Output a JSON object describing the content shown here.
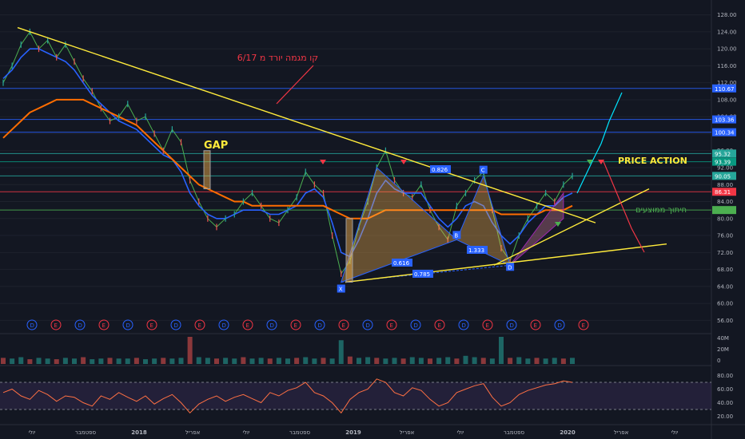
{
  "chart_data": {
    "type": "line",
    "title": "",
    "xlabel": "",
    "ylabel": "",
    "ylim": [
      54,
      130
    ],
    "x_ticks": [
      "יולי",
      "ספטמבר",
      "2018",
      "אפריל",
      "יולי",
      "ספטמבר",
      "2019",
      "אפריל",
      "יולי",
      "ספטמבר",
      "2020",
      "אפריל",
      "יולי"
    ],
    "y_ticks": [
      "128.00",
      "124.00",
      "120.00",
      "116.00",
      "112.00",
      "108.00",
      "104.00",
      "100.00",
      "96.00",
      "92.00",
      "88.00",
      "84.00",
      "80.00",
      "76.00",
      "72.00",
      "68.00",
      "64.00",
      "60.00",
      "56.00"
    ],
    "price_labels": [
      {
        "value": 110.67,
        "text": "110.67",
        "color": "#2962ff"
      },
      {
        "value": 103.36,
        "text": "103.36",
        "color": "#2962ff"
      },
      {
        "value": 100.34,
        "text": "100.34",
        "color": "#2962ff"
      },
      {
        "value": 95.32,
        "text": "95.32",
        "color": "#26a69a"
      },
      {
        "value": 93.39,
        "text": "93.39",
        "color": "#089981"
      },
      {
        "value": 90.05,
        "text": "90.05",
        "color": "#26a69a"
      },
      {
        "value": 86.31,
        "text": "86.31",
        "color": "#f23645"
      },
      {
        "value": 82.0,
        "text": "",
        "color": "#4caf50"
      }
    ],
    "series": [
      {
        "values": [
          112,
          116,
          121,
          124,
          120,
          122,
          118,
          121,
          117,
          113,
          110,
          106,
          103,
          104,
          107,
          103,
          104,
          100,
          96,
          101,
          98,
          89,
          84,
          80,
          78,
          80,
          81,
          84,
          86,
          83,
          80,
          79,
          82,
          85,
          91,
          88,
          86,
          76,
          67,
          70,
          78,
          84,
          92,
          96,
          89,
          86,
          85,
          88,
          82,
          78,
          75,
          83,
          86,
          89,
          91,
          82,
          73,
          70,
          76,
          80,
          83,
          86,
          84,
          88,
          90
        ]
      },
      {
        "values": [
          113,
          115,
          118,
          120,
          120,
          119,
          118,
          117,
          115,
          112,
          109,
          107,
          105,
          103,
          102,
          101,
          99,
          97,
          95,
          94,
          91,
          86,
          83,
          81,
          80,
          80,
          81,
          82,
          82,
          82,
          81,
          81,
          82,
          83,
          86,
          87,
          85,
          79,
          72,
          71,
          75,
          80,
          86,
          89,
          87,
          86,
          86,
          86,
          83,
          80,
          78,
          80,
          83,
          84,
          83,
          79,
          76,
          74,
          76,
          79,
          81,
          83,
          83,
          85,
          86
        ]
      },
      {
        "values": [
          99,
          101,
          103,
          105,
          106,
          107,
          108,
          108,
          108,
          108,
          107,
          106,
          105,
          104,
          103,
          102,
          100,
          98,
          96,
          94,
          92,
          90,
          88,
          87,
          86,
          85,
          84,
          84,
          83,
          83,
          83,
          83,
          83,
          83,
          83,
          83,
          83,
          82,
          81,
          80,
          80,
          80,
          81,
          82,
          82,
          82,
          82,
          82,
          82,
          82,
          82,
          82,
          82,
          82,
          82,
          82,
          81,
          81,
          81,
          81,
          81,
          82,
          82,
          82,
          83
        ]
      }
    ],
    "volume": [
      9,
      8,
      10,
      7,
      9,
      8,
      7,
      9,
      8,
      10,
      7,
      8,
      9,
      8,
      8,
      9,
      7,
      8,
      9,
      8,
      9,
      40,
      10,
      9,
      8,
      9,
      8,
      10,
      8,
      9,
      8,
      9,
      8,
      9,
      10,
      8,
      9,
      8,
      35,
      11,
      9,
      10,
      9,
      8,
      9,
      8,
      10,
      9,
      8,
      9,
      10,
      8,
      12,
      10,
      9,
      8,
      40,
      9,
      10,
      8,
      9,
      8,
      9,
      8,
      9
    ],
    "volume_ticks": [
      "40M",
      "20M",
      "0"
    ],
    "rsi": [
      55,
      60,
      50,
      45,
      58,
      52,
      42,
      50,
      48,
      40,
      35,
      50,
      45,
      55,
      48,
      42,
      50,
      38,
      46,
      52,
      40,
      25,
      38,
      45,
      50,
      42,
      48,
      52,
      46,
      40,
      55,
      50,
      58,
      62,
      70,
      55,
      50,
      40,
      25,
      45,
      55,
      60,
      75,
      70,
      55,
      50,
      62,
      58,
      45,
      35,
      40,
      55,
      60,
      65,
      68,
      48,
      35,
      40,
      52,
      58,
      62,
      66,
      68,
      72,
      70
    ],
    "rsi_ticks": [
      "80.00",
      "60.00",
      "40.00",
      "20.00"
    ],
    "annotations": {
      "trendline_label": "קו מגמה יורד מ 6/17",
      "gap": "GAP",
      "price_action": "PRICE ACTION",
      "ma_label": "חיתוך ממוצעים",
      "pattern_points": [
        "X",
        "B",
        "C",
        "D"
      ],
      "ratios": [
        "0.826",
        "0.616",
        "0.785",
        "1.333"
      ],
      "earnings_markers": [
        "D",
        "E",
        "D",
        "E",
        "D",
        "E",
        "D",
        "E",
        "D",
        "E",
        "D",
        "E",
        "D",
        "E",
        "D",
        "E",
        "D",
        "E",
        "D",
        "E",
        "D",
        "E",
        "D",
        "E"
      ]
    }
  }
}
